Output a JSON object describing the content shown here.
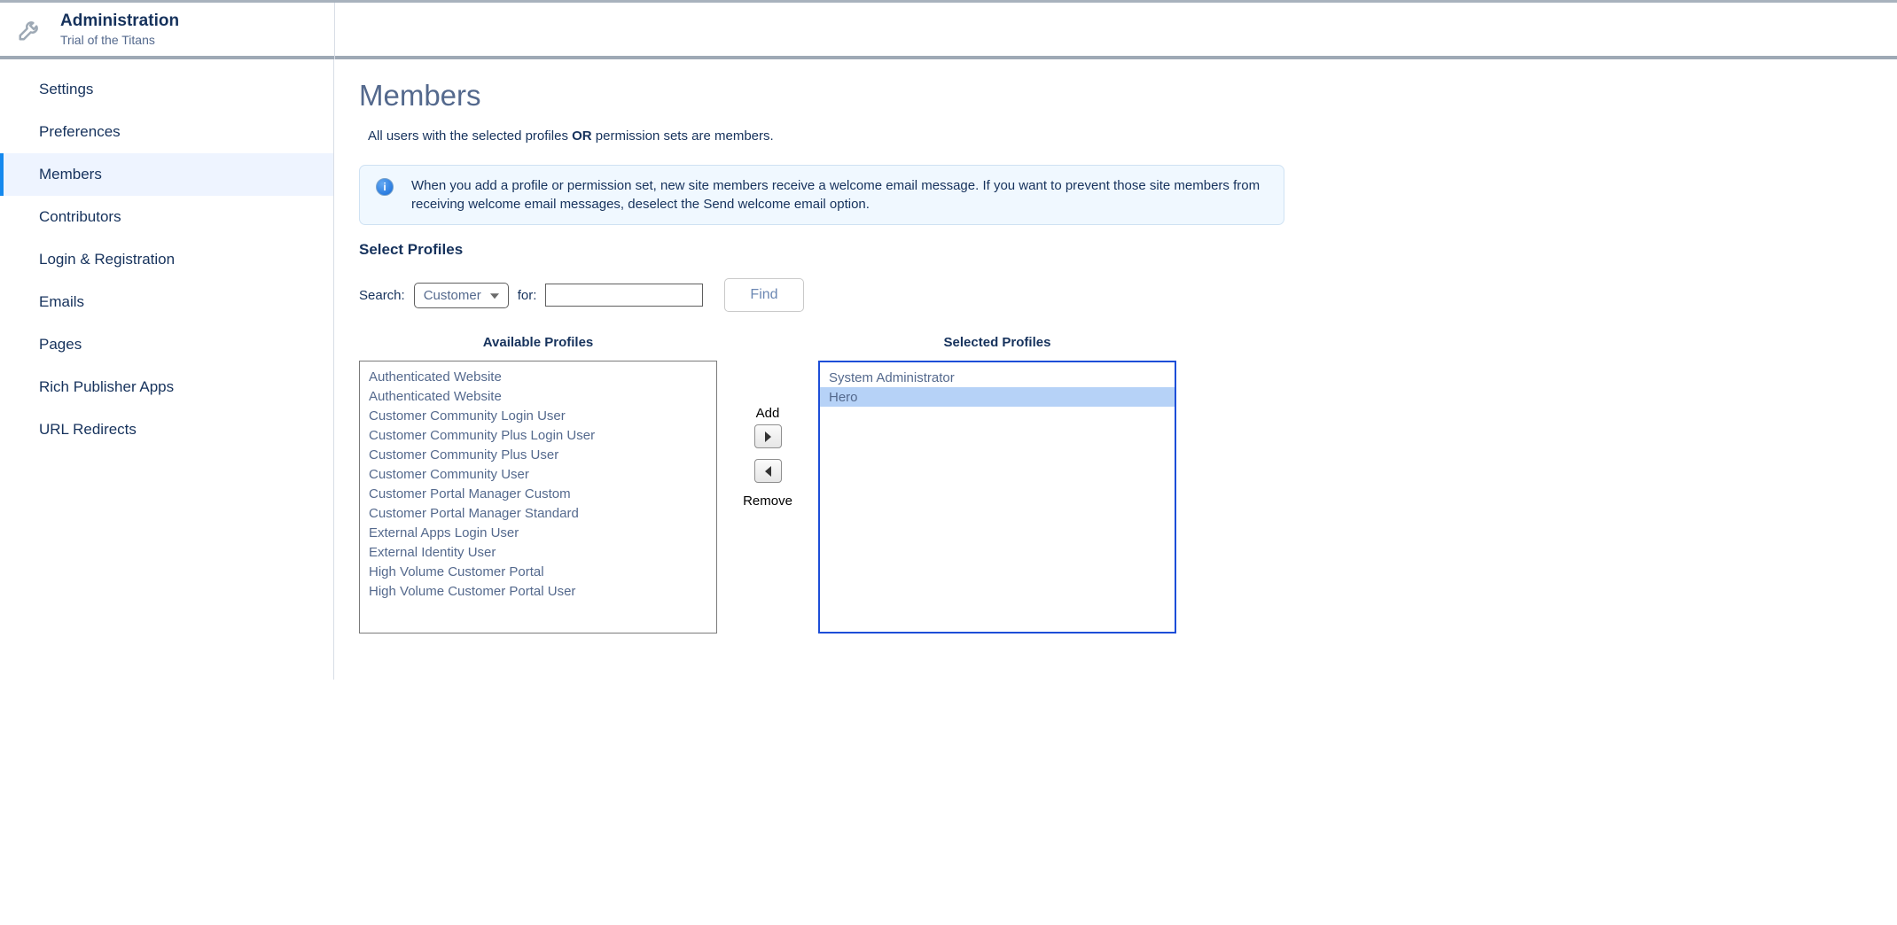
{
  "header": {
    "title": "Administration",
    "subtitle": "Trial of the Titans"
  },
  "sidebar": {
    "items": [
      {
        "label": "Settings",
        "active": false
      },
      {
        "label": "Preferences",
        "active": false
      },
      {
        "label": "Members",
        "active": true
      },
      {
        "label": "Contributors",
        "active": false
      },
      {
        "label": "Login & Registration",
        "active": false
      },
      {
        "label": "Emails",
        "active": false
      },
      {
        "label": "Pages",
        "active": false
      },
      {
        "label": "Rich Publisher Apps",
        "active": false
      },
      {
        "label": "URL Redirects",
        "active": false
      }
    ]
  },
  "main": {
    "page_title": "Members",
    "subhead_prefix": "All users with the selected profiles ",
    "subhead_bold": "OR",
    "subhead_suffix": " permission sets are members.",
    "info_icon_letter": "i",
    "info_text": "When you add a profile or permission set, new site members receive a welcome email message. If you want to prevent those site members from receiving welcome email messages, deselect the Send welcome email option.",
    "section_label": "Select Profiles",
    "search": {
      "label": "Search:",
      "dropdown_value": "Customer",
      "for_label": "for:",
      "input_value": "",
      "find_label": "Find"
    },
    "duel": {
      "available_header": "Available Profiles",
      "selected_header": "Selected Profiles",
      "add_label": "Add",
      "remove_label": "Remove",
      "available": [
        {
          "label": "Authenticated Website",
          "selected": false
        },
        {
          "label": "Authenticated Website",
          "selected": false
        },
        {
          "label": "Customer Community Login User",
          "selected": false
        },
        {
          "label": "Customer Community Plus Login User",
          "selected": false
        },
        {
          "label": "Customer Community Plus User",
          "selected": false
        },
        {
          "label": "Customer Community User",
          "selected": false
        },
        {
          "label": "Customer Portal Manager Custom",
          "selected": false
        },
        {
          "label": "Customer Portal Manager Standard",
          "selected": false
        },
        {
          "label": "External Apps Login User",
          "selected": false
        },
        {
          "label": "External Identity User",
          "selected": false
        },
        {
          "label": "High Volume Customer Portal",
          "selected": false
        },
        {
          "label": "High Volume Customer Portal User",
          "selected": false
        }
      ],
      "selected": [
        {
          "label": "System Administrator",
          "selected": false
        },
        {
          "label": "Hero",
          "selected": true
        }
      ]
    }
  }
}
